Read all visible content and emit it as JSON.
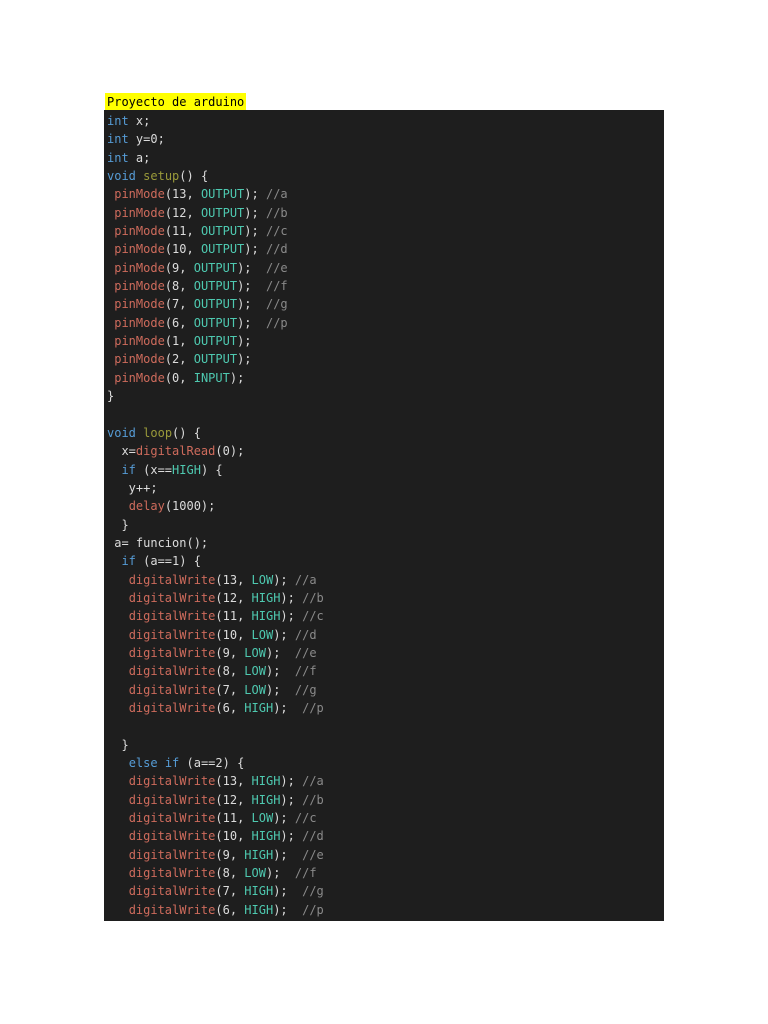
{
  "page": {
    "title": "Proyecto de arduino"
  },
  "code": {
    "lines": [
      [
        [
          "kw",
          "int"
        ],
        [
          "pl",
          " x;"
        ]
      ],
      [
        [
          "kw",
          "int"
        ],
        [
          "pl",
          " y=0;"
        ]
      ],
      [
        [
          "kw",
          "int"
        ],
        [
          "pl",
          " a;"
        ]
      ],
      [
        [
          "kw",
          "void"
        ],
        [
          "pl",
          " "
        ],
        [
          "fy",
          "setup"
        ],
        [
          "pl",
          "() {"
        ]
      ],
      [
        [
          "pl",
          " "
        ],
        [
          "fn",
          "pinMode"
        ],
        [
          "pl",
          "(13, "
        ],
        [
          "cn",
          "OUTPUT"
        ],
        [
          "pl",
          "); "
        ],
        [
          "cm",
          "//a"
        ]
      ],
      [
        [
          "pl",
          " "
        ],
        [
          "fn",
          "pinMode"
        ],
        [
          "pl",
          "(12, "
        ],
        [
          "cn",
          "OUTPUT"
        ],
        [
          "pl",
          "); "
        ],
        [
          "cm",
          "//b"
        ]
      ],
      [
        [
          "pl",
          " "
        ],
        [
          "fn",
          "pinMode"
        ],
        [
          "pl",
          "(11, "
        ],
        [
          "cn",
          "OUTPUT"
        ],
        [
          "pl",
          "); "
        ],
        [
          "cm",
          "//c"
        ]
      ],
      [
        [
          "pl",
          " "
        ],
        [
          "fn",
          "pinMode"
        ],
        [
          "pl",
          "(10, "
        ],
        [
          "cn",
          "OUTPUT"
        ],
        [
          "pl",
          "); "
        ],
        [
          "cm",
          "//d"
        ]
      ],
      [
        [
          "pl",
          " "
        ],
        [
          "fn",
          "pinMode"
        ],
        [
          "pl",
          "(9, "
        ],
        [
          "cn",
          "OUTPUT"
        ],
        [
          "pl",
          ");  "
        ],
        [
          "cm",
          "//e"
        ]
      ],
      [
        [
          "pl",
          " "
        ],
        [
          "fn",
          "pinMode"
        ],
        [
          "pl",
          "(8, "
        ],
        [
          "cn",
          "OUTPUT"
        ],
        [
          "pl",
          ");  "
        ],
        [
          "cm",
          "//f"
        ]
      ],
      [
        [
          "pl",
          " "
        ],
        [
          "fn",
          "pinMode"
        ],
        [
          "pl",
          "(7, "
        ],
        [
          "cn",
          "OUTPUT"
        ],
        [
          "pl",
          ");  "
        ],
        [
          "cm",
          "//g"
        ]
      ],
      [
        [
          "pl",
          " "
        ],
        [
          "fn",
          "pinMode"
        ],
        [
          "pl",
          "(6, "
        ],
        [
          "cn",
          "OUTPUT"
        ],
        [
          "pl",
          ");  "
        ],
        [
          "cm",
          "//p"
        ]
      ],
      [
        [
          "pl",
          " "
        ],
        [
          "fn",
          "pinMode"
        ],
        [
          "pl",
          "(1, "
        ],
        [
          "cn",
          "OUTPUT"
        ],
        [
          "pl",
          ");"
        ]
      ],
      [
        [
          "pl",
          " "
        ],
        [
          "fn",
          "pinMode"
        ],
        [
          "pl",
          "(2, "
        ],
        [
          "cn",
          "OUTPUT"
        ],
        [
          "pl",
          ");"
        ]
      ],
      [
        [
          "pl",
          " "
        ],
        [
          "fn",
          "pinMode"
        ],
        [
          "pl",
          "(0, "
        ],
        [
          "cn",
          "INPUT"
        ],
        [
          "pl",
          ");"
        ]
      ],
      [
        [
          "pl",
          "}"
        ]
      ],
      [],
      [
        [
          "kw",
          "void"
        ],
        [
          "pl",
          " "
        ],
        [
          "fy",
          "loop"
        ],
        [
          "pl",
          "() {"
        ]
      ],
      [
        [
          "pl",
          "  x="
        ],
        [
          "fn",
          "digitalRead"
        ],
        [
          "pl",
          "(0);"
        ]
      ],
      [
        [
          "pl",
          "  "
        ],
        [
          "kw",
          "if"
        ],
        [
          "pl",
          " (x=="
        ],
        [
          "cn",
          "HIGH"
        ],
        [
          "pl",
          ") {"
        ]
      ],
      [
        [
          "pl",
          "   y++;"
        ]
      ],
      [
        [
          "pl",
          "   "
        ],
        [
          "fn",
          "delay"
        ],
        [
          "pl",
          "(1000);"
        ]
      ],
      [
        [
          "pl",
          "  }"
        ]
      ],
      [
        [
          "pl",
          " a= funcion();"
        ]
      ],
      [
        [
          "pl",
          "  "
        ],
        [
          "kw",
          "if"
        ],
        [
          "pl",
          " (a==1) {"
        ]
      ],
      [
        [
          "pl",
          "   "
        ],
        [
          "fn",
          "digitalWrite"
        ],
        [
          "pl",
          "(13, "
        ],
        [
          "cn",
          "LOW"
        ],
        [
          "pl",
          "); "
        ],
        [
          "cm",
          "//a"
        ]
      ],
      [
        [
          "pl",
          "   "
        ],
        [
          "fn",
          "digitalWrite"
        ],
        [
          "pl",
          "(12, "
        ],
        [
          "cn",
          "HIGH"
        ],
        [
          "pl",
          "); "
        ],
        [
          "cm",
          "//b"
        ]
      ],
      [
        [
          "pl",
          "   "
        ],
        [
          "fn",
          "digitalWrite"
        ],
        [
          "pl",
          "(11, "
        ],
        [
          "cn",
          "HIGH"
        ],
        [
          "pl",
          "); "
        ],
        [
          "cm",
          "//c"
        ]
      ],
      [
        [
          "pl",
          "   "
        ],
        [
          "fn",
          "digitalWrite"
        ],
        [
          "pl",
          "(10, "
        ],
        [
          "cn",
          "LOW"
        ],
        [
          "pl",
          "); "
        ],
        [
          "cm",
          "//d"
        ]
      ],
      [
        [
          "pl",
          "   "
        ],
        [
          "fn",
          "digitalWrite"
        ],
        [
          "pl",
          "(9, "
        ],
        [
          "cn",
          "LOW"
        ],
        [
          "pl",
          ");  "
        ],
        [
          "cm",
          "//e"
        ]
      ],
      [
        [
          "pl",
          "   "
        ],
        [
          "fn",
          "digitalWrite"
        ],
        [
          "pl",
          "(8, "
        ],
        [
          "cn",
          "LOW"
        ],
        [
          "pl",
          ");  "
        ],
        [
          "cm",
          "//f"
        ]
      ],
      [
        [
          "pl",
          "   "
        ],
        [
          "fn",
          "digitalWrite"
        ],
        [
          "pl",
          "(7, "
        ],
        [
          "cn",
          "LOW"
        ],
        [
          "pl",
          ");  "
        ],
        [
          "cm",
          "//g"
        ]
      ],
      [
        [
          "pl",
          "   "
        ],
        [
          "fn",
          "digitalWrite"
        ],
        [
          "pl",
          "(6, "
        ],
        [
          "cn",
          "HIGH"
        ],
        [
          "pl",
          ");  "
        ],
        [
          "cm",
          "//p"
        ]
      ],
      [],
      [
        [
          "pl",
          "  }"
        ]
      ],
      [
        [
          "pl",
          "   "
        ],
        [
          "kw",
          "else"
        ],
        [
          "pl",
          " "
        ],
        [
          "kw",
          "if"
        ],
        [
          "pl",
          " (a==2) {"
        ]
      ],
      [
        [
          "pl",
          "   "
        ],
        [
          "fn",
          "digitalWrite"
        ],
        [
          "pl",
          "(13, "
        ],
        [
          "cn",
          "HIGH"
        ],
        [
          "pl",
          "); "
        ],
        [
          "cm",
          "//a"
        ]
      ],
      [
        [
          "pl",
          "   "
        ],
        [
          "fn",
          "digitalWrite"
        ],
        [
          "pl",
          "(12, "
        ],
        [
          "cn",
          "HIGH"
        ],
        [
          "pl",
          "); "
        ],
        [
          "cm",
          "//b"
        ]
      ],
      [
        [
          "pl",
          "   "
        ],
        [
          "fn",
          "digitalWrite"
        ],
        [
          "pl",
          "(11, "
        ],
        [
          "cn",
          "LOW"
        ],
        [
          "pl",
          "); "
        ],
        [
          "cm",
          "//c"
        ]
      ],
      [
        [
          "pl",
          "   "
        ],
        [
          "fn",
          "digitalWrite"
        ],
        [
          "pl",
          "(10, "
        ],
        [
          "cn",
          "HIGH"
        ],
        [
          "pl",
          "); "
        ],
        [
          "cm",
          "//d"
        ]
      ],
      [
        [
          "pl",
          "   "
        ],
        [
          "fn",
          "digitalWrite"
        ],
        [
          "pl",
          "(9, "
        ],
        [
          "cn",
          "HIGH"
        ],
        [
          "pl",
          ");  "
        ],
        [
          "cm",
          "//e"
        ]
      ],
      [
        [
          "pl",
          "   "
        ],
        [
          "fn",
          "digitalWrite"
        ],
        [
          "pl",
          "(8, "
        ],
        [
          "cn",
          "LOW"
        ],
        [
          "pl",
          ");  "
        ],
        [
          "cm",
          "//f"
        ]
      ],
      [
        [
          "pl",
          "   "
        ],
        [
          "fn",
          "digitalWrite"
        ],
        [
          "pl",
          "(7, "
        ],
        [
          "cn",
          "HIGH"
        ],
        [
          "pl",
          ");  "
        ],
        [
          "cm",
          "//g"
        ]
      ],
      [
        [
          "pl",
          "   "
        ],
        [
          "fn",
          "digitalWrite"
        ],
        [
          "pl",
          "(6, "
        ],
        [
          "cn",
          "HIGH"
        ],
        [
          "pl",
          ");  "
        ],
        [
          "cm",
          "//p"
        ]
      ]
    ]
  },
  "colors": {
    "keyword": "#569cd6",
    "function": "#ce6b5c",
    "setup_loop": "#9a9a3a",
    "constant": "#4ec9b0",
    "comment": "#8a8a8a",
    "plain": "#dcdcdc",
    "code_background": "#1e1e1e",
    "title_highlight": "#ffff00"
  }
}
